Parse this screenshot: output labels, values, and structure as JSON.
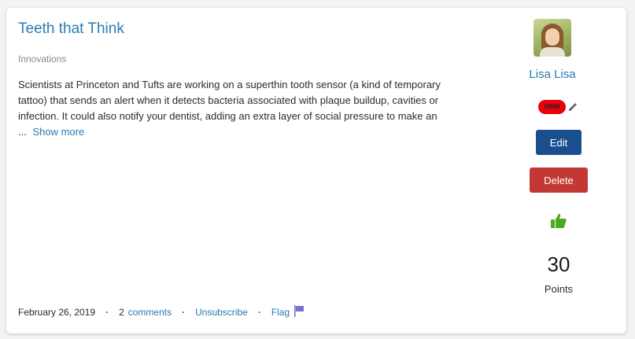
{
  "post": {
    "title": "Teeth that Think",
    "category": "Innovations",
    "body_lines": [
      "Scientists at Princeton and Tufts are working on a superthin tooth sensor (a kind of temporary",
      "tattoo) that sends an alert when it detects bacteria associated with plaque buildup, cavities or",
      "infection. It could also notify your dentist, adding an extra layer of social pressure to make an"
    ],
    "ellipsis": "...",
    "show_more": "Show more"
  },
  "meta": {
    "date": "February 26, 2019",
    "separator": "·",
    "comment_count": "2",
    "comments_label": "comments",
    "unsubscribe_label": "Unsubscribe",
    "flag_label": "Flag"
  },
  "author": {
    "name": "Lisa Lisa",
    "badge": "new"
  },
  "actions": {
    "edit_label": "Edit",
    "delete_label": "Delete"
  },
  "points": {
    "value": "30",
    "label": "Points"
  },
  "icons": {
    "flag": "flag-icon",
    "pencil": "pencil-icon",
    "like": "thumbs-up-icon"
  },
  "colors": {
    "link": "#2a7ab0",
    "edit_button": "#1a4f8f",
    "delete_button": "#c23934",
    "badge": "#e8000a",
    "like": "#4bab1e",
    "flag": "#7b6fd6"
  }
}
